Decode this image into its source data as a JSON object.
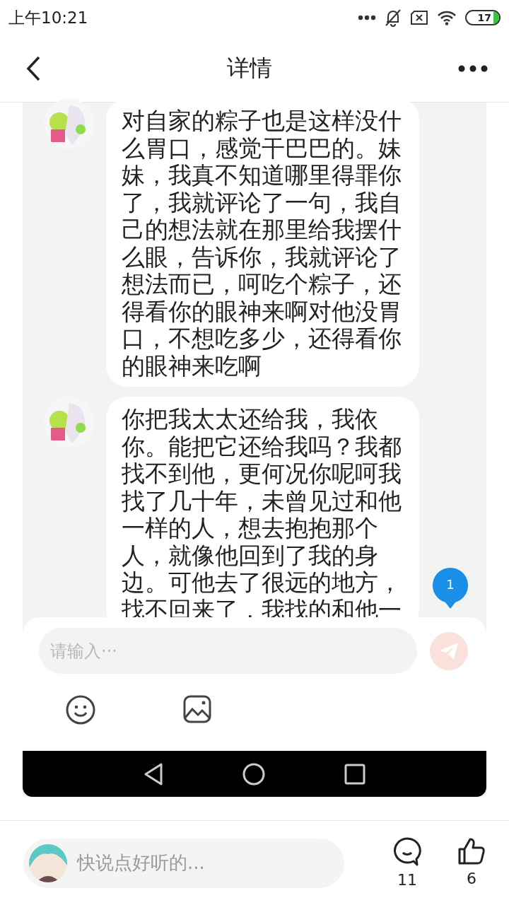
{
  "status_bar": {
    "time": "上午10:21",
    "battery": "17"
  },
  "header": {
    "title": "详情"
  },
  "screenshot": {
    "messages": [
      {
        "text": "对自家的粽子也是这样没什么胃口，感觉干巴巴的。妹妹，我真不知道哪里得罪你了，我就评论了一句，我自己的想法就在那里给我摆什么眼，告诉你，我就评论了想法而已，呵吃个粽子，还得看你的眼神来啊对他没胃口，不想吃多少，还得看你的眼神来吃啊"
      },
      {
        "text": "你把我太太还给我，我依你。能把它还给我吗？我都找不到他，更何况你呢呵我找了几十年，未曾见过和他一样的人，想去抱抱那个人，就像他回到了我的身边。可他去了很远的地方，找不回来了，我找的和他一"
      }
    ],
    "unread_badge": "1",
    "input": {
      "placeholder": "请输入···"
    }
  },
  "comment_bar": {
    "placeholder": "快说点好听的...",
    "comments": "11",
    "likes": "6"
  }
}
